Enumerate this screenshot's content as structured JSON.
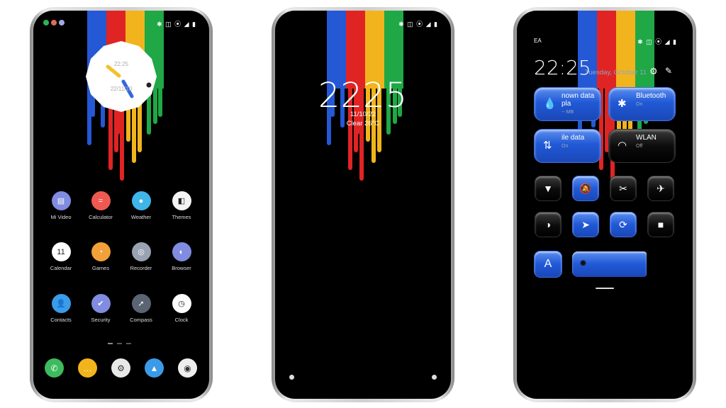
{
  "colors": {
    "blue": "#2458d4",
    "red": "#e02424",
    "yellow": "#f2b41c",
    "green": "#1fa845",
    "tile_on": "#2159d6"
  },
  "status": {
    "icons": "✱ ◫ ⦿ ◢ ▮"
  },
  "home": {
    "clock_widget": {
      "time": "22:25",
      "date": "22/11/10"
    },
    "apps": [
      {
        "label": "Mi Video",
        "icon": "clapper-icon",
        "glyph": "▤",
        "color": "#7f8ce0"
      },
      {
        "label": "Calculator",
        "icon": "calculator-icon",
        "glyph": "=",
        "color": "#ef5a50"
      },
      {
        "label": "Weather",
        "icon": "sun-icon",
        "glyph": "●",
        "color": "#3fb5e8"
      },
      {
        "label": "Themes",
        "icon": "themes-icon",
        "glyph": "◧",
        "color": "#f4f4f4"
      },
      {
        "label": "Calendar",
        "icon": "calendar-icon",
        "glyph": "11",
        "color": "#ffffff"
      },
      {
        "label": "Games",
        "icon": "games-icon",
        "glyph": "◔",
        "color": "#f2a03a"
      },
      {
        "label": "Recorder",
        "icon": "recorder-icon",
        "glyph": "◎",
        "color": "#98a2b3"
      },
      {
        "label": "Browser",
        "icon": "browser-icon",
        "glyph": "◐",
        "color": "#7f8ce0"
      },
      {
        "label": "Contacts",
        "icon": "contact-icon",
        "glyph": "👤",
        "color": "#3b9be8"
      },
      {
        "label": "Security",
        "icon": "shield-icon",
        "glyph": "✔",
        "color": "#7f8ce0"
      },
      {
        "label": "Compass",
        "icon": "compass-icon",
        "glyph": "➚",
        "color": "#5b6472"
      },
      {
        "label": "Clock",
        "icon": "clock-icon",
        "glyph": "◷",
        "color": "#ffffff"
      }
    ],
    "dock": [
      {
        "icon": "phone-icon",
        "glyph": "✆",
        "color": "#3dbb5e"
      },
      {
        "icon": "messages-icon",
        "glyph": "…",
        "color": "#f2b41c"
      },
      {
        "icon": "settings-icon",
        "glyph": "⚙",
        "color": "#e8e8e8"
      },
      {
        "icon": "gallery-icon",
        "glyph": "▲",
        "color": "#3b9be8"
      },
      {
        "icon": "camera-icon",
        "glyph": "◉",
        "color": "#eeeeee"
      }
    ]
  },
  "lock": {
    "time": "2225",
    "date": "11/10/22",
    "weather": "Clear 26°C"
  },
  "control": {
    "carrier": "EA",
    "time": "22:25",
    "date": "Tuesday, October 11",
    "tiles": [
      {
        "title": "nown data pla",
        "sub": "-- MB",
        "icon": "drop-icon",
        "glyph": "💧",
        "on": true
      },
      {
        "title": "Bluetooth",
        "sub": "On",
        "icon": "bluetooth-icon",
        "glyph": "✱",
        "on": true
      },
      {
        "title": "ile data",
        "sub": "On",
        "icon": "mobile-data-icon",
        "glyph": "⇅",
        "on": true
      },
      {
        "title": "WLAN",
        "sub": "Off",
        "icon": "wifi-icon",
        "glyph": "◠",
        "on": false
      }
    ],
    "toggles": [
      {
        "icon": "flashlight-icon",
        "glyph": "▼",
        "on": false
      },
      {
        "icon": "mute-icon",
        "glyph": "🔕",
        "on": true
      },
      {
        "icon": "screenshot-icon",
        "glyph": "✂",
        "on": false
      },
      {
        "icon": "airplane-icon",
        "glyph": "✈",
        "on": false
      },
      {
        "icon": "dark-mode-icon",
        "glyph": "◑",
        "on": false
      },
      {
        "icon": "location-icon",
        "glyph": "➤",
        "on": true
      },
      {
        "icon": "rotation-lock-icon",
        "glyph": "⟳",
        "on": true
      },
      {
        "icon": "screen-record-icon",
        "glyph": "■",
        "on": false
      }
    ],
    "auto_brightness_glyph": "A",
    "brightness_level": 0.72
  }
}
